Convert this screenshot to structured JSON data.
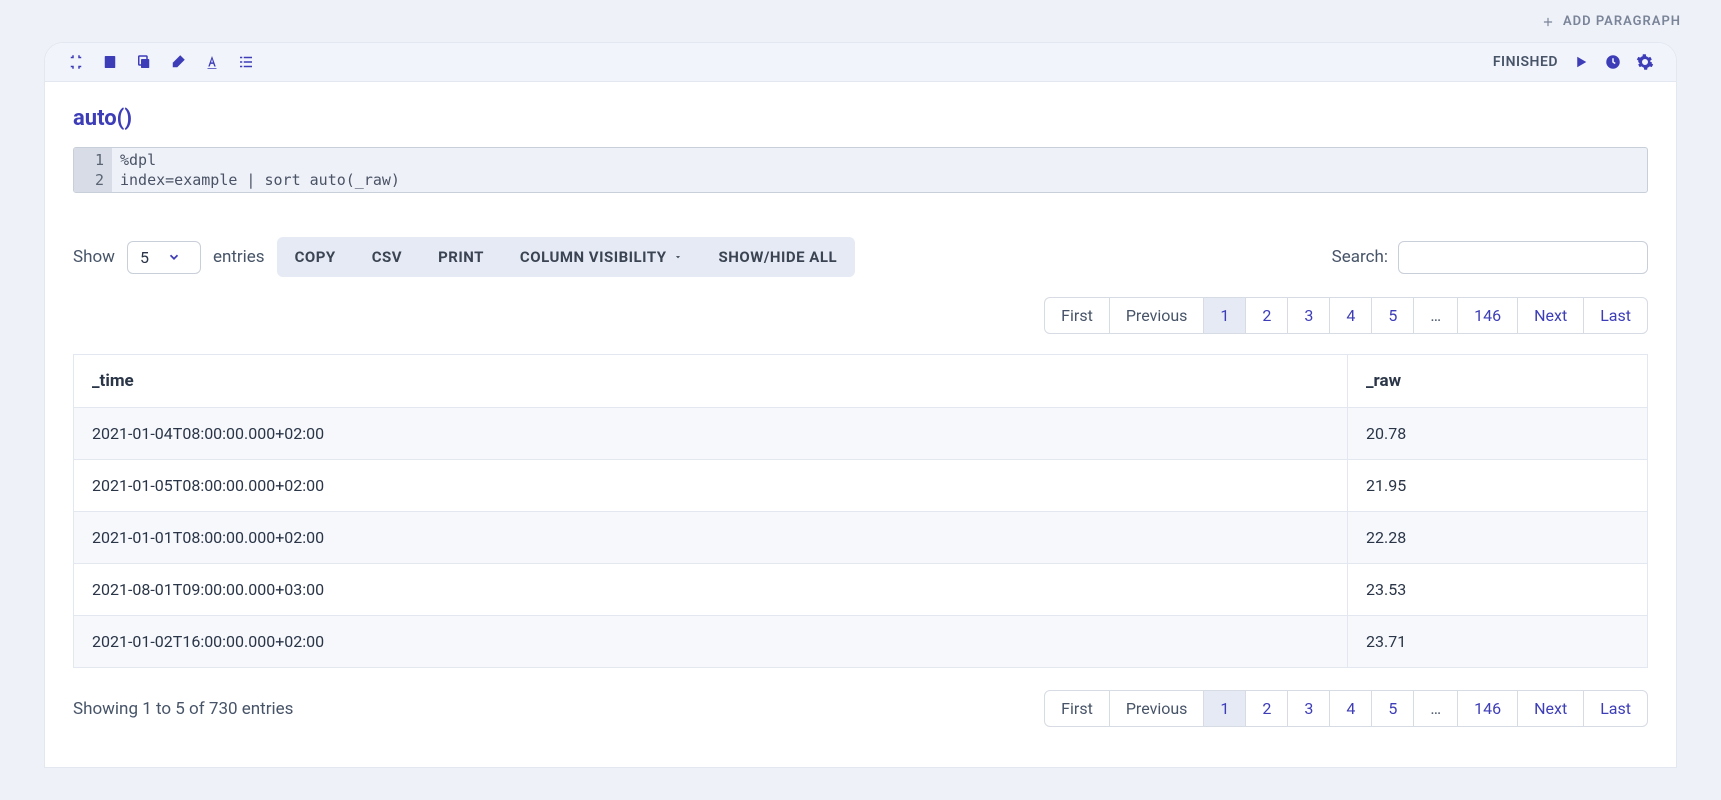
{
  "add_paragraph_label": "ADD PARAGRAPH",
  "status": "FINISHED",
  "title": "auto()",
  "code": {
    "lines": [
      "%dpl",
      "index=example | sort auto(_raw)"
    ]
  },
  "table_controls": {
    "show_label": "Show",
    "entries_label": "entries",
    "page_size": "5",
    "buttons": {
      "copy": "COPY",
      "csv": "CSV",
      "print": "PRINT",
      "colvis": "COLUMN VISIBILITY",
      "showhide": "SHOW/HIDE ALL"
    },
    "search_label": "Search:"
  },
  "pagination": {
    "first": "First",
    "previous": "Previous",
    "pages": [
      "1",
      "2",
      "3",
      "4",
      "5"
    ],
    "ellipsis": "…",
    "last_page": "146",
    "next": "Next",
    "last": "Last",
    "active": "1"
  },
  "columns": [
    "_time",
    "_raw"
  ],
  "rows": [
    {
      "time": "2021-01-04T08:00:00.000+02:00",
      "raw": "20.78"
    },
    {
      "time": "2021-01-05T08:00:00.000+02:00",
      "raw": "21.95"
    },
    {
      "time": "2021-01-01T08:00:00.000+02:00",
      "raw": "22.28"
    },
    {
      "time": "2021-08-01T09:00:00.000+03:00",
      "raw": "23.53"
    },
    {
      "time": "2021-01-02T16:00:00.000+02:00",
      "raw": "23.71"
    }
  ],
  "info": "Showing 1 to 5 of 730 entries"
}
